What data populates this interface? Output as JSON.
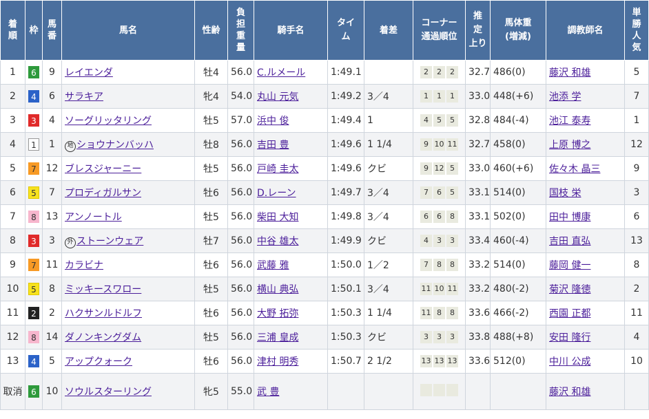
{
  "headers": {
    "rank": [
      "着",
      "順"
    ],
    "waku": "枠",
    "umaban": [
      "馬",
      "番"
    ],
    "horse": "馬名",
    "sex_age": "性齢",
    "weight_carried": [
      "負",
      "担",
      "重",
      "量"
    ],
    "jockey": "騎手名",
    "time": [
      "タイ",
      "ム"
    ],
    "margin": "着差",
    "corner": [
      "コーナー",
      "通過順位"
    ],
    "last3f": [
      "推",
      "定",
      "上り"
    ],
    "body_weight": [
      "馬体重",
      "(増減)"
    ],
    "trainer": "調教師名",
    "popularity": [
      "単",
      "勝",
      "人",
      "気"
    ]
  },
  "waku_colors": {
    "1": {
      "bg": "#ffffff",
      "fg": "#333333",
      "border": "#999999"
    },
    "2": {
      "bg": "#222222",
      "fg": "#ffffff",
      "border": "#222222"
    },
    "3": {
      "bg": "#e02a2a",
      "fg": "#ffffff",
      "border": "#e02a2a"
    },
    "4": {
      "bg": "#2b62c8",
      "fg": "#ffffff",
      "border": "#2b62c8"
    },
    "5": {
      "bg": "#f7e21e",
      "fg": "#333333",
      "border": "#e0c800"
    },
    "6": {
      "bg": "#2e9a3c",
      "fg": "#ffffff",
      "border": "#2e9a3c"
    },
    "7": {
      "bg": "#f79a25",
      "fg": "#333333",
      "border": "#f79a25"
    },
    "8": {
      "bg": "#f7b6cd",
      "fg": "#333333",
      "border": "#f7b6cd"
    }
  },
  "rows": [
    {
      "rank": "1",
      "waku": "6",
      "umaban": "9",
      "prefix": "",
      "horse": "レイエンダ",
      "sex_age": "牡4",
      "weight": "56.0",
      "jockey": "C.ルメール",
      "time": "1:49.1",
      "margin": "",
      "corners": [
        "2",
        "2",
        "2"
      ],
      "last3f": "32.7",
      "body_weight": "486(0)",
      "trainer": "藤沢 和雄",
      "popularity": "5"
    },
    {
      "rank": "2",
      "waku": "4",
      "umaban": "6",
      "prefix": "",
      "horse": "サラキア",
      "sex_age": "牝4",
      "weight": "54.0",
      "jockey": "丸山 元気",
      "time": "1:49.2",
      "margin": "3／4",
      "corners": [
        "1",
        "1",
        "1"
      ],
      "last3f": "33.0",
      "body_weight": "448(+6)",
      "trainer": "池添 学",
      "popularity": "7"
    },
    {
      "rank": "3",
      "waku": "3",
      "umaban": "4",
      "prefix": "",
      "horse": "ソーグリッタリング",
      "sex_age": "牡5",
      "weight": "57.0",
      "jockey": "浜中 俊",
      "time": "1:49.4",
      "margin": "1",
      "corners": [
        "4",
        "5",
        "5"
      ],
      "last3f": "32.8",
      "body_weight": "484(-4)",
      "trainer": "池江 泰寿",
      "popularity": "1"
    },
    {
      "rank": "4",
      "waku": "1",
      "umaban": "1",
      "prefix": "地",
      "horse": "ショウナンバッハ",
      "sex_age": "牡8",
      "weight": "56.0",
      "jockey": "吉田 豊",
      "time": "1:49.6",
      "margin": "1 1/4",
      "corners": [
        "9",
        "10",
        "11"
      ],
      "last3f": "32.7",
      "body_weight": "458(0)",
      "trainer": "上原 博之",
      "popularity": "12"
    },
    {
      "rank": "5",
      "waku": "7",
      "umaban": "12",
      "prefix": "",
      "horse": "ブレスジャーニー",
      "sex_age": "牡5",
      "weight": "56.0",
      "jockey": "戸崎 圭太",
      "time": "1:49.6",
      "margin": "クビ",
      "corners": [
        "9",
        "12",
        "5"
      ],
      "last3f": "33.0",
      "body_weight": "460(+6)",
      "trainer": "佐々木 晶三",
      "popularity": "9"
    },
    {
      "rank": "6",
      "waku": "5",
      "umaban": "7",
      "prefix": "",
      "horse": "プロディガルサン",
      "sex_age": "牡6",
      "weight": "56.0",
      "jockey": "D.レーン",
      "time": "1:49.7",
      "margin": "3／4",
      "corners": [
        "7",
        "6",
        "5"
      ],
      "last3f": "33.1",
      "body_weight": "514(0)",
      "trainer": "国枝 栄",
      "popularity": "3"
    },
    {
      "rank": "7",
      "waku": "8",
      "umaban": "13",
      "prefix": "",
      "horse": "アンノートル",
      "sex_age": "牡5",
      "weight": "56.0",
      "jockey": "柴田 大知",
      "time": "1:49.8",
      "margin": "3／4",
      "corners": [
        "6",
        "6",
        "8"
      ],
      "last3f": "33.1",
      "body_weight": "502(0)",
      "trainer": "田中 博康",
      "popularity": "6"
    },
    {
      "rank": "8",
      "waku": "3",
      "umaban": "3",
      "prefix": "外",
      "horse": "ストーンウェア",
      "sex_age": "牡7",
      "weight": "56.0",
      "jockey": "中谷 雄太",
      "time": "1:49.9",
      "margin": "クビ",
      "corners": [
        "4",
        "3",
        "3"
      ],
      "last3f": "33.4",
      "body_weight": "460(-4)",
      "trainer": "吉田 直弘",
      "popularity": "13"
    },
    {
      "rank": "9",
      "waku": "7",
      "umaban": "11",
      "prefix": "",
      "horse": "カラビナ",
      "sex_age": "牡6",
      "weight": "56.0",
      "jockey": "武藤 雅",
      "time": "1:50.0",
      "margin": "1／2",
      "corners": [
        "7",
        "8",
        "8"
      ],
      "last3f": "33.2",
      "body_weight": "514(0)",
      "trainer": "藤岡 健一",
      "popularity": "8"
    },
    {
      "rank": "10",
      "waku": "5",
      "umaban": "8",
      "prefix": "",
      "horse": "ミッキースワロー",
      "sex_age": "牡5",
      "weight": "56.0",
      "jockey": "横山 典弘",
      "time": "1:50.1",
      "margin": "3／4",
      "corners": [
        "11",
        "10",
        "11"
      ],
      "last3f": "33.2",
      "body_weight": "480(-2)",
      "trainer": "菊沢 隆徳",
      "popularity": "2"
    },
    {
      "rank": "11",
      "waku": "2",
      "umaban": "2",
      "prefix": "",
      "horse": "ハクサンルドルフ",
      "sex_age": "牡6",
      "weight": "56.0",
      "jockey": "大野 拓弥",
      "time": "1:50.3",
      "margin": "1 1/4",
      "corners": [
        "11",
        "8",
        "8"
      ],
      "last3f": "33.6",
      "body_weight": "466(-2)",
      "trainer": "西園 正都",
      "popularity": "11"
    },
    {
      "rank": "12",
      "waku": "8",
      "umaban": "14",
      "prefix": "",
      "horse": "ダノンキングダム",
      "sex_age": "牡5",
      "weight": "56.0",
      "jockey": "三浦 皇成",
      "time": "1:50.3",
      "margin": "クビ",
      "corners": [
        "3",
        "3",
        "3"
      ],
      "last3f": "33.8",
      "body_weight": "488(+8)",
      "trainer": "安田 隆行",
      "popularity": "4"
    },
    {
      "rank": "13",
      "waku": "4",
      "umaban": "5",
      "prefix": "",
      "horse": "アップクォーク",
      "sex_age": "牡6",
      "weight": "56.0",
      "jockey": "津村 明秀",
      "time": "1:50.7",
      "margin": "2 1/2",
      "corners": [
        "13",
        "13",
        "13"
      ],
      "last3f": "33.6",
      "body_weight": "512(0)",
      "trainer": "中川 公成",
      "popularity": "10"
    },
    {
      "rank": "取消",
      "waku": "6",
      "umaban": "10",
      "prefix": "",
      "horse": "ソウルスターリング",
      "sex_age": "牝5",
      "weight": "55.0",
      "jockey": "武 豊",
      "time": "",
      "margin": "",
      "corners": [
        "",
        "",
        ""
      ],
      "last3f": "",
      "body_weight": "",
      "trainer": "藤沢 和雄",
      "popularity": ""
    }
  ]
}
